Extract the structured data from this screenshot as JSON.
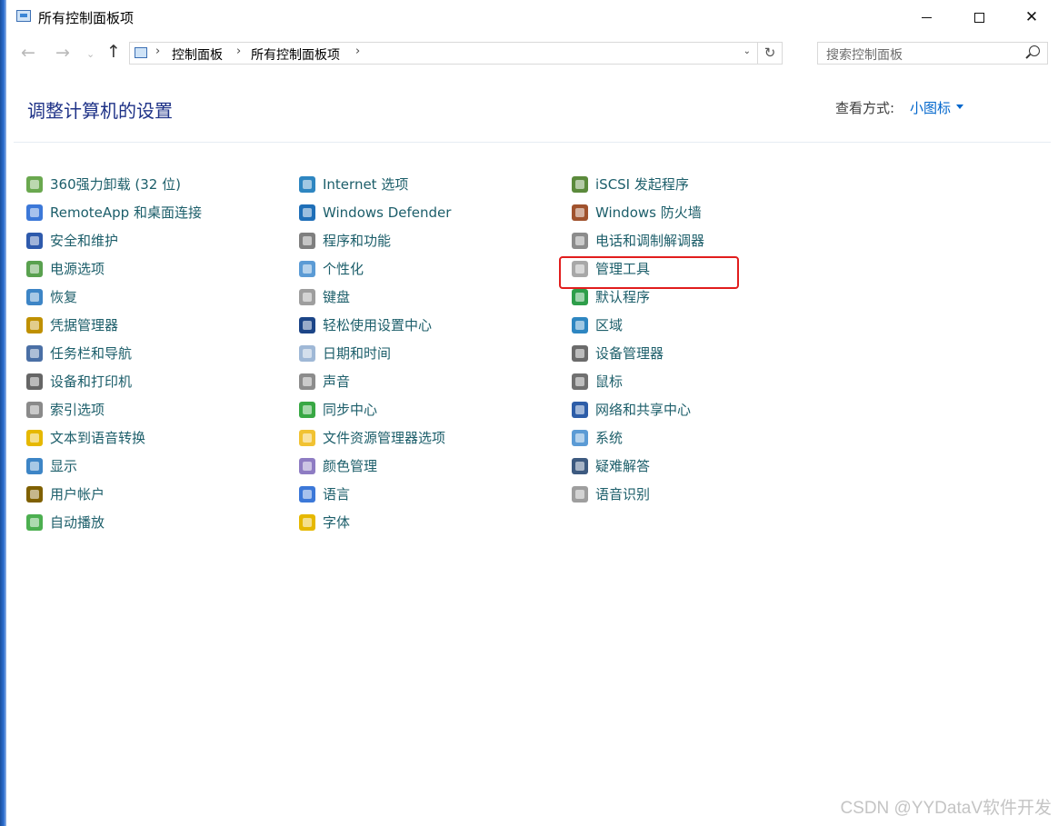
{
  "window": {
    "title": "所有控制面板项",
    "icons": {
      "minimize": "minimize-icon",
      "maximize": "maximize-icon",
      "close": "close-icon"
    }
  },
  "nav": {
    "back_glyph": "←",
    "forward_glyph": "→",
    "dropdown_glyph": "⌄",
    "up_glyph": "↑",
    "breadcrumbs": [
      "控制面板",
      "所有控制面板项"
    ],
    "separator": "›",
    "refresh_glyph": "↻",
    "address_dropdown_glyph": "⌄"
  },
  "search": {
    "placeholder": "搜索控制面板"
  },
  "header": {
    "title": "调整计算机的设置",
    "view_by_label": "查看方式:",
    "view_by_value": "小图标"
  },
  "items": {
    "col1": [
      {
        "label": "360强力卸载 (32 位)",
        "icon": "uninstall-icon",
        "color": "#6aa84f"
      },
      {
        "label": "RemoteApp 和桌面连接",
        "icon": "remote-desktop-icon",
        "color": "#3c78d8"
      },
      {
        "label": "安全和维护",
        "icon": "flag-icon",
        "color": "#2e5aac"
      },
      {
        "label": "电源选项",
        "icon": "power-icon",
        "color": "#59a14f"
      },
      {
        "label": "恢复",
        "icon": "recovery-icon",
        "color": "#3d85c6"
      },
      {
        "label": "凭据管理器",
        "icon": "credential-icon",
        "color": "#bf9000"
      },
      {
        "label": "任务栏和导航",
        "icon": "taskbar-icon",
        "color": "#4a6fa5"
      },
      {
        "label": "设备和打印机",
        "icon": "printer-icon",
        "color": "#666666"
      },
      {
        "label": "索引选项",
        "icon": "index-icon",
        "color": "#8a8a8a"
      },
      {
        "label": "文本到语音转换",
        "icon": "speech-bubble-icon",
        "color": "#e6b800"
      },
      {
        "label": "显示",
        "icon": "display-icon",
        "color": "#3d85c6"
      },
      {
        "label": "用户帐户",
        "icon": "users-icon",
        "color": "#7f6000"
      },
      {
        "label": "自动播放",
        "icon": "autoplay-icon",
        "color": "#4caf50"
      }
    ],
    "col2": [
      {
        "label": "Internet 选项",
        "icon": "internet-icon",
        "color": "#2e86c1"
      },
      {
        "label": "Windows Defender",
        "icon": "shield-icon",
        "color": "#1f6fb8"
      },
      {
        "label": "程序和功能",
        "icon": "programs-icon",
        "color": "#7f7f7f"
      },
      {
        "label": "个性化",
        "icon": "personalize-icon",
        "color": "#5b9bd5"
      },
      {
        "label": "键盘",
        "icon": "keyboard-icon",
        "color": "#9e9e9e"
      },
      {
        "label": "轻松使用设置中心",
        "icon": "accessibility-icon",
        "color": "#1c4587"
      },
      {
        "label": "日期和时间",
        "icon": "calendar-icon",
        "color": "#9fb8d6"
      },
      {
        "label": "声音",
        "icon": "speaker-icon",
        "color": "#8c8c8c"
      },
      {
        "label": "同步中心",
        "icon": "sync-icon",
        "color": "#38a844"
      },
      {
        "label": "文件资源管理器选项",
        "icon": "folder-icon",
        "color": "#f1c232"
      },
      {
        "label": "颜色管理",
        "icon": "color-icon",
        "color": "#8e7cc3"
      },
      {
        "label": "语言",
        "icon": "language-icon",
        "color": "#3c78d8"
      },
      {
        "label": "字体",
        "icon": "font-icon",
        "color": "#e6b800"
      }
    ],
    "col3": [
      {
        "label": "iSCSI 发起程序",
        "icon": "iscsi-icon",
        "color": "#5b8a3c"
      },
      {
        "label": "Windows 防火墙",
        "icon": "firewall-icon",
        "color": "#a0522d"
      },
      {
        "label": "电话和调制解调器",
        "icon": "phone-icon",
        "color": "#8c8c8c"
      },
      {
        "label": "管理工具",
        "icon": "admin-tools-icon",
        "color": "#a8a8a8"
      },
      {
        "label": "默认程序",
        "icon": "default-programs-icon",
        "color": "#2e9e4a"
      },
      {
        "label": "区域",
        "icon": "globe-icon",
        "color": "#2e86c1"
      },
      {
        "label": "设备管理器",
        "icon": "device-manager-icon",
        "color": "#6b6b6b"
      },
      {
        "label": "鼠标",
        "icon": "mouse-icon",
        "color": "#707070"
      },
      {
        "label": "网络和共享中心",
        "icon": "network-icon",
        "color": "#2d5da8"
      },
      {
        "label": "系统",
        "icon": "computer-icon",
        "color": "#5b9bd5"
      },
      {
        "label": "疑难解答",
        "icon": "troubleshoot-icon",
        "color": "#3d5a80"
      },
      {
        "label": "语音识别",
        "icon": "microphone-icon",
        "color": "#9e9e9e"
      }
    ]
  },
  "watermark": "CSDN @YYDataV软件开发"
}
